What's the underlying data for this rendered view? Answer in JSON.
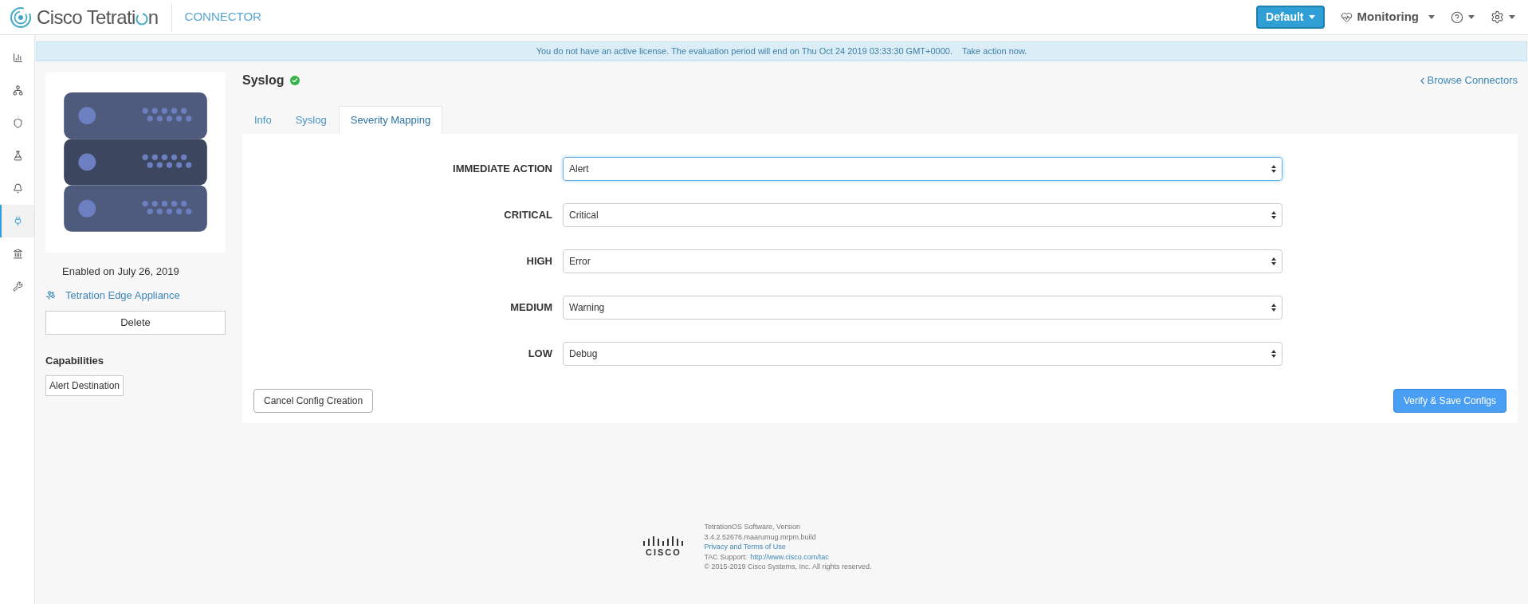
{
  "header": {
    "brand_before": "Cisco Tetrati",
    "brand_after": "n",
    "section": "CONNECTOR",
    "scope_button": "Default",
    "monitoring": "Monitoring"
  },
  "sidebar": {
    "items": [
      {
        "kind": "chart",
        "selected": false
      },
      {
        "kind": "network",
        "selected": false
      },
      {
        "kind": "shield",
        "selected": false
      },
      {
        "kind": "flask",
        "selected": false
      },
      {
        "kind": "bell",
        "selected": false
      },
      {
        "kind": "plug",
        "selected": true
      },
      {
        "kind": "bank",
        "selected": false
      },
      {
        "kind": "wrench",
        "selected": false
      }
    ]
  },
  "banner": {
    "message": "You do not have an active license. The evaluation period will end on Thu Oct 24 2019 03:33:30 GMT+0000.",
    "link": "Take action now."
  },
  "connector": {
    "enabled": "Enabled on July 26, 2019",
    "appliance": "Tetration Edge Appliance",
    "delete_button": "Delete",
    "capabilities_title": "Capabilities",
    "capabilities": [
      "Alert Destination"
    ]
  },
  "page": {
    "title": "Syslog",
    "status_ok": true,
    "browse_link": "Browse Connectors"
  },
  "tabs": [
    {
      "label": "Info",
      "selected": false
    },
    {
      "label": "Syslog",
      "selected": false
    },
    {
      "label": "Severity Mapping",
      "selected": true
    }
  ],
  "mapping": [
    {
      "label": "IMMEDIATE ACTION",
      "value": "Alert",
      "focused": true
    },
    {
      "label": "CRITICAL",
      "value": "Critical",
      "focused": false
    },
    {
      "label": "HIGH",
      "value": "Error",
      "focused": false
    },
    {
      "label": "MEDIUM",
      "value": "Warning",
      "focused": false
    },
    {
      "label": "LOW",
      "value": "Debug",
      "focused": false
    }
  ],
  "actions": {
    "cancel": "Cancel Config Creation",
    "save": "Verify & Save Configs"
  },
  "footer": {
    "line_1": "TetrationOS Software, Version",
    "line_2": "3.4.2.52676.maarumug.mrpm.build",
    "privacy": "Privacy and Terms of Use",
    "tac_label": "TAC Support:",
    "tac_link": "http://www.cisco.com/tac",
    "copyright": "© 2015-2019 Cisco Systems, Inc. All rights reserved.",
    "logo_text": "CISCO"
  }
}
